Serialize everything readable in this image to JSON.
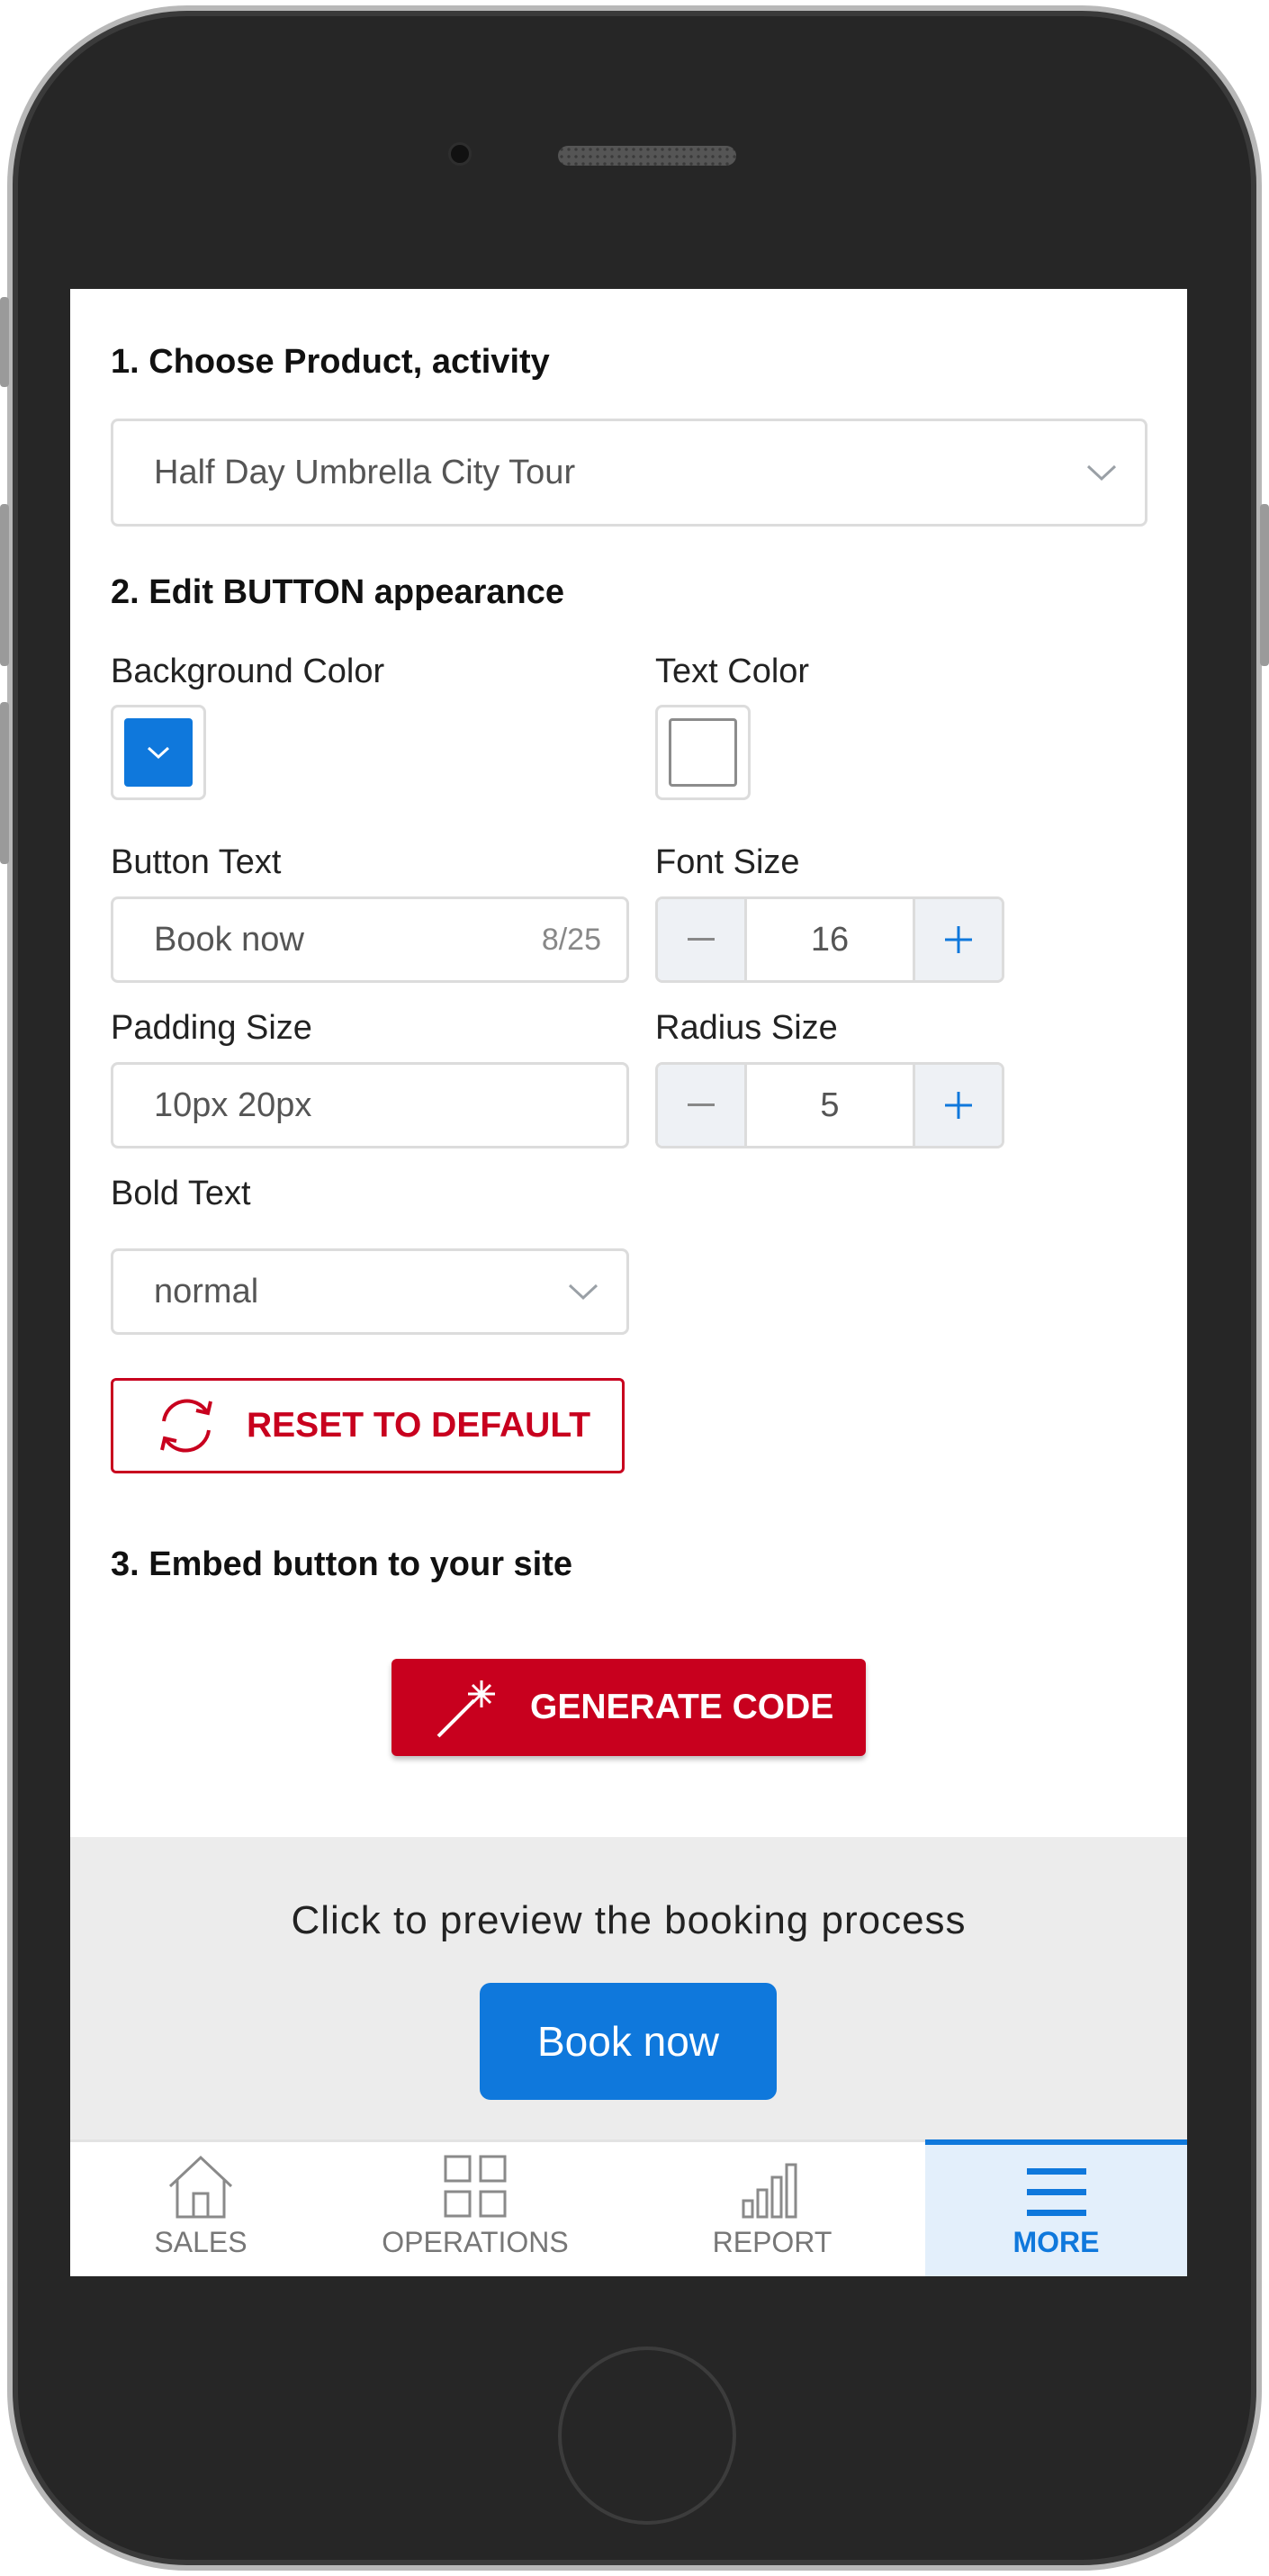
{
  "section1": {
    "title": "1. Choose Product, activity",
    "product_select_value": "Half Day Umbrella City Tour"
  },
  "section2": {
    "title": "2. Edit BUTTON appearance",
    "background_color_label": "Background Color",
    "background_color_value": "#0f78dc",
    "text_color_label": "Text Color",
    "text_color_value": "#ffffff",
    "button_text_label": "Button Text",
    "button_text_value": "Book now",
    "button_text_counter": "8/25",
    "font_size_label": "Font Size",
    "font_size_value": "16",
    "padding_size_label": "Padding Size",
    "padding_size_value": "10px 20px",
    "radius_size_label": "Radius Size",
    "radius_size_value": "5",
    "bold_text_label": "Bold Text",
    "bold_text_value": "normal",
    "reset_label": "RESET TO DEFAULT"
  },
  "section3": {
    "title": "3. Embed button to your site",
    "generate_label": "GENERATE CODE"
  },
  "preview": {
    "text": "Click to preview the booking process",
    "button_label": "Book now"
  },
  "tabbar": {
    "tabs": [
      {
        "label": "SALES",
        "icon": "home-icon"
      },
      {
        "label": "OPERATIONS",
        "icon": "grid-icon"
      },
      {
        "label": "REPORT",
        "icon": "bar-chart-icon"
      },
      {
        "label": "MORE",
        "icon": "menu-icon",
        "active": true
      }
    ]
  },
  "colors": {
    "accent": "#0f78dc",
    "danger": "#c8001e"
  }
}
